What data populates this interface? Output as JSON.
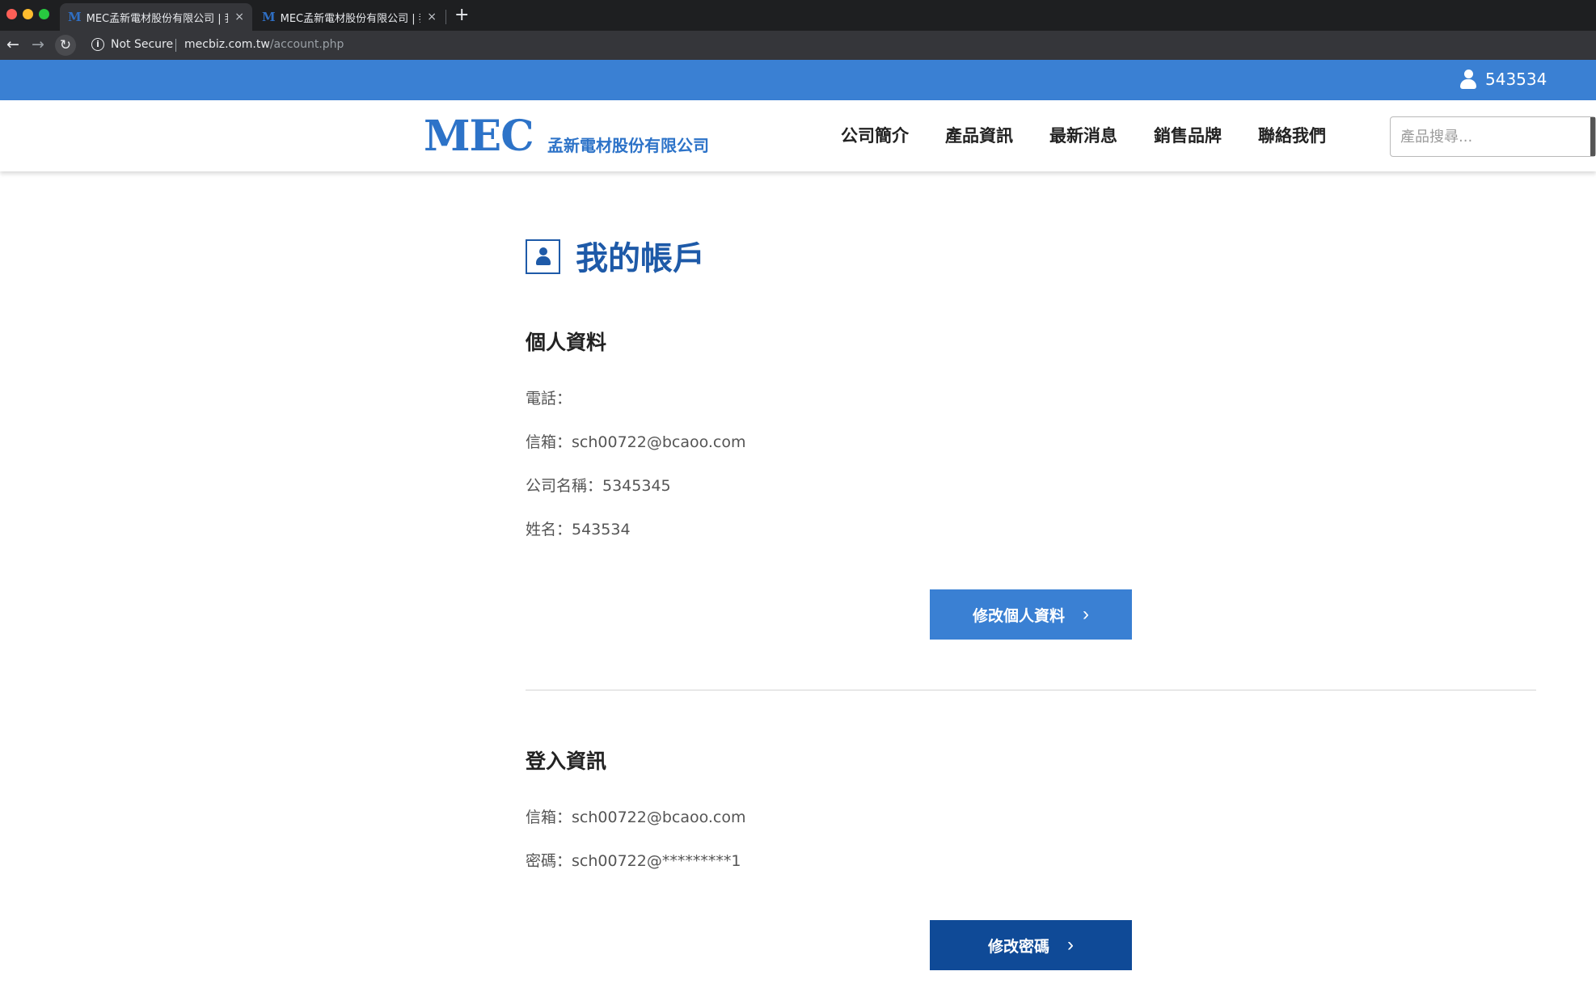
{
  "browser": {
    "tabs": [
      {
        "favicon": "M",
        "title": "MEC孟新電材股份有限公司 | 我",
        "active": true
      },
      {
        "favicon": "M",
        "title": "MEC孟新電材股份有限公司 | 我",
        "active": false
      }
    ],
    "new_tab": "+",
    "close_glyph": "×",
    "security_label": "Not Secure",
    "url_domain": "mecbiz.com.tw",
    "url_path": "/account.php"
  },
  "topbar": {
    "username": "543534"
  },
  "header": {
    "logo_mark": "MEC",
    "logo_text": "孟新電材股份有限公司",
    "nav": [
      "公司簡介",
      "產品資訊",
      "最新消息",
      "銷售品牌",
      "聯絡我們"
    ],
    "search_placeholder": "產品搜尋..."
  },
  "main": {
    "page_title": "我的帳戶",
    "personal": {
      "title": "個人資料",
      "phone": "電話：",
      "email": "信箱：sch00722@bcaoo.com",
      "company": "公司名稱：5345345",
      "name": "姓名：543534",
      "edit_button": "修改個人資料"
    },
    "login": {
      "title": "登入資訊",
      "email": "信箱：sch00722@bcaoo.com",
      "password": "密碼：sch00722@*********1",
      "change_button": "修改密碼"
    }
  },
  "colors": {
    "topbar_blue": "#3a80d3",
    "brand_blue": "#2d73c8",
    "title_blue": "#1e5aa8",
    "dark_button": "#0f4a97"
  },
  "icons": {
    "back": "arrow-left-icon",
    "forward": "arrow-right-icon",
    "reload": "reload-icon",
    "security": "info-icon",
    "user": "user-icon",
    "account": "account-icon",
    "chevron": "chevron-right-icon"
  }
}
